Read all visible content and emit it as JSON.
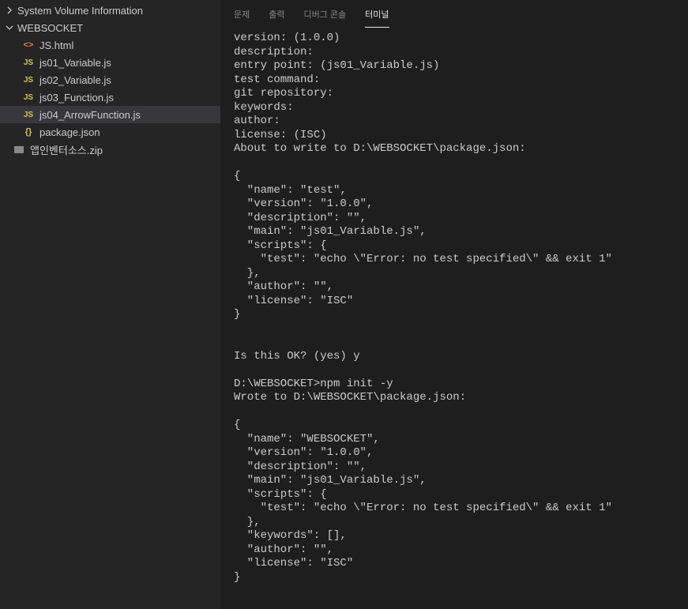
{
  "sidebar": {
    "folder1": {
      "name": "System Volume Information",
      "expanded": false
    },
    "folder2": {
      "name": "WEBSOCKET",
      "expanded": true
    },
    "files": [
      {
        "icon": "<>",
        "iconClass": "icon-html",
        "name": "JS.html"
      },
      {
        "icon": "JS",
        "iconClass": "icon-js",
        "name": "js01_Variable.js"
      },
      {
        "icon": "JS",
        "iconClass": "icon-js",
        "name": "js02_Variable.js"
      },
      {
        "icon": "JS",
        "iconClass": "icon-js",
        "name": "js03_Function.js"
      },
      {
        "icon": "JS",
        "iconClass": "icon-js",
        "name": "js04_ArrowFunction.js",
        "selected": true
      },
      {
        "icon": "{}",
        "iconClass": "icon-json",
        "name": "package.json"
      }
    ],
    "rootFile": {
      "icon": "▭",
      "iconClass": "icon-zip",
      "name": "앱인벤터소스.zip"
    }
  },
  "panelTabs": {
    "tab1": "문제",
    "tab2": "출력",
    "tab3": "디버그 콘솔",
    "tab4": "터미널"
  },
  "terminal": {
    "content": "version: (1.0.0)\ndescription:\nentry point: (js01_Variable.js)\ntest command:\ngit repository:\nkeywords:\nauthor:\nlicense: (ISC)\nAbout to write to D:\\WEBSOCKET\\package.json:\n\n{\n  \"name\": \"test\",\n  \"version\": \"1.0.0\",\n  \"description\": \"\",\n  \"main\": \"js01_Variable.js\",\n  \"scripts\": {\n    \"test\": \"echo \\\"Error: no test specified\\\" && exit 1\"\n  },\n  \"author\": \"\",\n  \"license\": \"ISC\"\n}\n\n\nIs this OK? (yes) y\n\nD:\\WEBSOCKET>npm init -y\nWrote to D:\\WEBSOCKET\\package.json:\n\n{\n  \"name\": \"WEBSOCKET\",\n  \"version\": \"1.0.0\",\n  \"description\": \"\",\n  \"main\": \"js01_Variable.js\",\n  \"scripts\": {\n    \"test\": \"echo \\\"Error: no test specified\\\" && exit 1\"\n  },\n  \"keywords\": [],\n  \"author\": \"\",\n  \"license\": \"ISC\"\n}"
  }
}
